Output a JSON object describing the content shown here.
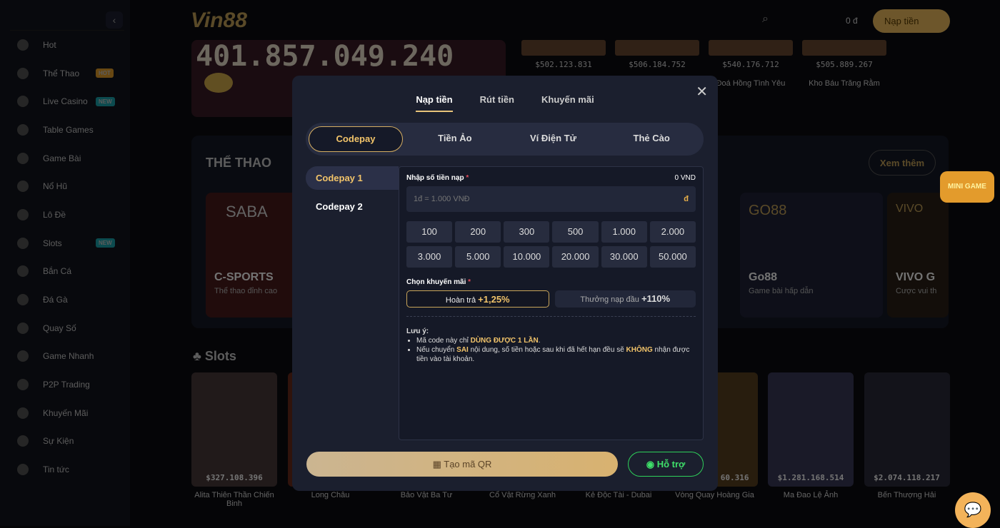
{
  "sidebar": {
    "items": [
      {
        "label": "Hot"
      },
      {
        "label": "Thể Thao",
        "badge": "HOT"
      },
      {
        "label": "Live Casino",
        "badge": "NEW"
      },
      {
        "label": "Table Games"
      },
      {
        "label": "Game Bài"
      },
      {
        "label": "Nổ Hũ"
      },
      {
        "label": "Lô Đề"
      },
      {
        "label": "Slots",
        "badge": "NEW"
      },
      {
        "label": "Bắn Cá"
      },
      {
        "label": "Đá Gà"
      },
      {
        "label": "Quay Số"
      },
      {
        "label": "Game Nhanh"
      },
      {
        "label": "P2P Trading"
      },
      {
        "label": "Khuyến Mãi"
      },
      {
        "label": "Sự Kiện"
      },
      {
        "label": "Tin tức"
      }
    ]
  },
  "header": {
    "logo": "Vin88",
    "balance": "0 đ",
    "deposit": "Nạp tiền"
  },
  "jackpot": {
    "value": "401.857.049.240"
  },
  "top_games": [
    {
      "value": "$502.123.831",
      "name": ""
    },
    {
      "value": "$506.184.752",
      "name": ""
    },
    {
      "value": "$540.176.712",
      "name": "Đoá Hồng Tình Yêu"
    },
    {
      "value": "$505.889.267",
      "name": "Kho Báu Trăng Rằm"
    }
  ],
  "sports": {
    "title": "THỂ THAO",
    "more": "Xem thêm",
    "cards": [
      {
        "logo": "SABA",
        "title": "C-SPORTS",
        "sub": "Thể thao đỉnh cao"
      },
      {
        "logo": "GO88",
        "title": "Go88",
        "sub": "Game bài hấp dẫn"
      },
      {
        "logo": "VIVO",
        "title": "VIVO G",
        "sub": "Cược vui th"
      }
    ]
  },
  "slots": {
    "title": "Slots",
    "games": [
      {
        "name": "Alita Thiên Thần Chiến Binh",
        "value": "$327.108.396"
      },
      {
        "name": "Long Châu",
        "value": ""
      },
      {
        "name": "Bảo Vật Ba Tư",
        "value": ""
      },
      {
        "name": "Cổ Vật Rừng Xanh",
        "value": ""
      },
      {
        "name": "Kẻ Độc Tài - Dubai",
        "value": ""
      },
      {
        "name": "Vòng Quay Hoàng Gia",
        "value": "60.316"
      },
      {
        "name": "Ma Đao Lệ Ảnh",
        "value": "$1.281.168.514"
      },
      {
        "name": "Bến Thượng Hải",
        "value": "$2.074.118.217"
      }
    ]
  },
  "minigame": "MINI GAME",
  "modal": {
    "tabs": [
      "Nạp tiền",
      "Rút tiền",
      "Khuyến mãi"
    ],
    "methods": [
      "Codepay",
      "Tiền Ảo",
      "Ví Điện Tử",
      "Thẻ Cào"
    ],
    "sub_methods": [
      "Codepay 1",
      "Codepay 2"
    ],
    "amount_label": "Nhập số tiền nạp",
    "amount_value": "0 VND",
    "amount_placeholder": "1đ = 1.000 VNĐ",
    "currency": "đ",
    "amounts": [
      "100",
      "200",
      "300",
      "500",
      "1.000",
      "2.000",
      "3.000",
      "5.000",
      "10.000",
      "20.000",
      "30.000",
      "50.000"
    ],
    "promo_label": "Chọn khuyến mãi",
    "promos": [
      {
        "label": "Hoàn trả",
        "value": "+1,25%"
      },
      {
        "label": "Thưởng nạp đầu",
        "value": "+110%"
      }
    ],
    "note": {
      "title": "Lưu ý:",
      "l1a": "Mã code này chỉ ",
      "l1b": "DÙNG ĐƯỢC 1 LẦN",
      ".": ".",
      "l2a": "Nếu chuyển ",
      "l2b": "SAI",
      "l2c": " nội dung, số tiền hoặc sau khi đã hết hạn đều sẽ ",
      "l2d": "KHÔNG",
      "l2e": " nhận được tiền vào tài khoản."
    },
    "qr_button": "Tạo mã QR",
    "help_button": "Hỗ trợ"
  },
  "colors": {
    "accent": "#f2c46a",
    "support": "#3fe06a",
    "modal_bg": "#1b1f2e"
  }
}
